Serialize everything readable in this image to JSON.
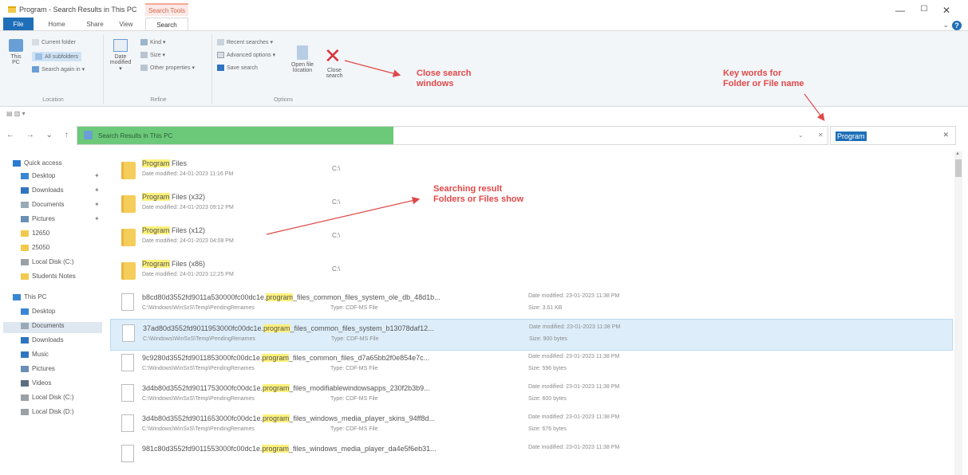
{
  "window": {
    "title": "Program - Search Results in This PC",
    "context_tab": "Search Tools",
    "controls": [
      "—",
      "☐",
      "✕"
    ]
  },
  "ribbon_tabs": [
    "File",
    "Home",
    "Share",
    "View",
    "Search"
  ],
  "ribbon": {
    "location": {
      "label": "Location",
      "this_pc": "This PC",
      "current_folder": "Current folder",
      "all_subfolders": "All subfolders",
      "search_again": "Search again in ▾"
    },
    "refine": {
      "label": "Refine",
      "date_modified": "Date modified ▾",
      "kind": "Kind ▾",
      "size": "Size ▾",
      "other": "Other properties ▾"
    },
    "options": {
      "label": "Options",
      "recent": "Recent searches ▾",
      "advanced": "Advanced options ▾",
      "save": "Save search",
      "open_location": "Open file location",
      "close_search": "Close search"
    }
  },
  "address": {
    "path": "Search Results in This PC",
    "search_value": "Program",
    "clear_icon": "✕"
  },
  "nav": {
    "items": [
      {
        "label": "Quick access",
        "color": "#2a7bd1"
      },
      {
        "label": "Desktop",
        "color": "#3a86d4"
      },
      {
        "label": "Downloads",
        "color": "#2f74c0"
      },
      {
        "label": "Documents",
        "color": "#9aa9b8"
      },
      {
        "label": "Pictures",
        "color": "#6b8fb5"
      },
      {
        "label": "12650",
        "color": "#f2c94c"
      },
      {
        "label": "25050",
        "color": "#f2c94c"
      },
      {
        "label": "Local Disk (C:)",
        "color": "#9aa0a6"
      },
      {
        "label": "Students Notes",
        "color": "#f2c94c"
      },
      {
        "label": "This PC",
        "color": "#3a86d4"
      },
      {
        "label": "Desktop",
        "color": "#3a86d4"
      },
      {
        "label": "Documents",
        "color": "#9aa9b8"
      },
      {
        "label": "Downloads",
        "color": "#2f74c0"
      },
      {
        "label": "Music",
        "color": "#2f74c0"
      },
      {
        "label": "Pictures",
        "color": "#6b8fb5"
      },
      {
        "label": "Videos",
        "color": "#5c6f82"
      },
      {
        "label": "Local Disk (C:)",
        "color": "#9aa0a6"
      },
      {
        "label": "Local Disk (D:)",
        "color": "#9aa0a6"
      }
    ]
  },
  "folders": [
    {
      "hl": "Program",
      "rest": " Files",
      "date": "Date modified: 24-01-2023 11:16 PM",
      "loc": "C:\\"
    },
    {
      "hl": "Program",
      "rest": " Files (x32)",
      "date": "Date modified: 24-01-2023 09:12 PM",
      "loc": "C:\\"
    },
    {
      "hl": "Program",
      "rest": " Files (x12)",
      "date": "Date modified: 24-01-2023 04:08 PM",
      "loc": "C:\\"
    },
    {
      "hl": "Program",
      "rest": " Files (x86)",
      "date": "Date modified: 24-01-2023 12:25 PM",
      "loc": "C:\\"
    }
  ],
  "files": [
    {
      "pre": "b8cd80d3552fd9011a530000fc00dc1e.",
      "hl": "program",
      "post": "_files_common_files_system_ole_db_48d1b...",
      "path": "C:\\Windows\\WinSxS\\Temp\\PendingRenames",
      "type": "Type: CDF-MS File",
      "date": "Date modified: 23-01-2023 11:38 PM",
      "size": "Size: 3.61 KB"
    },
    {
      "pre": "37ad80d3552fd9011953000fc00dc1e.",
      "hl": "program",
      "post": "_files_common_files_system_b13078daf12...",
      "path": "C:\\Windows\\WinSxS\\Temp\\PendingRenames",
      "type": "Type: CDF-MS File",
      "date": "Date modified: 23-01-2023 11:38 PM",
      "size": "Size: 900 bytes"
    },
    {
      "pre": "9c9280d3552fd9011853000fc00dc1e.",
      "hl": "program",
      "post": "_files_common_files_d7a65bb2f0e854e7c...",
      "path": "C:\\Windows\\WinSxS\\Temp\\PendingRenames",
      "type": "Type: CDF-MS File",
      "date": "Date modified: 23-01-2023 11:38 PM",
      "size": "Size: 596 bytes"
    },
    {
      "pre": "3d4b80d3552fd9011753000fc00dc1e.",
      "hl": "program",
      "post": "_files_modifiablewindowsapps_230f2b3b9...",
      "path": "C:\\Windows\\WinSxS\\Temp\\PendingRenames",
      "type": "Type: CDF-MS File",
      "date": "Date modified: 23-01-2023 11:38 PM",
      "size": "Size: 600 bytes"
    },
    {
      "pre": "3d4b80d3552fd9011653000fc00dc1e.",
      "hl": "program",
      "post": "_files_windows_media_player_skins_94ff8d...",
      "path": "C:\\Windows\\WinSxS\\Temp\\PendingRenames",
      "type": "Type: CDF-MS File",
      "date": "Date modified: 23-01-2023 11:38 PM",
      "size": "Size: 676 bytes"
    },
    {
      "pre": "981c80d3552fd9011553000fc00dc1e.",
      "hl": "program",
      "post": "_files_windows_media_player_da4e5f6eb31...",
      "path": "",
      "type": "",
      "date": "Date modified: 23-01-2023 11:38 PM",
      "size": ""
    }
  ],
  "annotations": {
    "close": [
      "Close search",
      "windows"
    ],
    "keywords": [
      "Key words for",
      "Folder or File name"
    ],
    "results": [
      "Searching result",
      "Folders or Files show"
    ]
  }
}
